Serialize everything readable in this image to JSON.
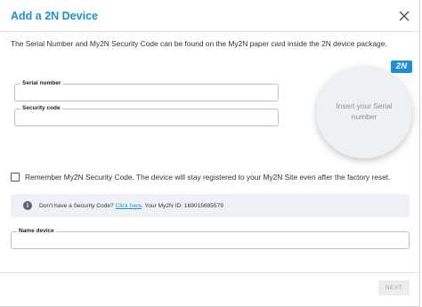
{
  "dialog": {
    "title": "Add a 2N Device",
    "description": "The Serial Number and My2N Security Code can be found on the My2N paper card inside the 2N device package."
  },
  "form": {
    "serial_label": "Serial number",
    "serial_value": "",
    "security_label": "Security code",
    "security_value": "",
    "name_label": "Name device",
    "name_value": ""
  },
  "logo": {
    "text": "2N"
  },
  "scan": {
    "hint": "Insert your Serial number"
  },
  "remember": {
    "checked": false,
    "label": "Remember My2N Security Code. The device will stay registered to your My2N Site even after the factory reset."
  },
  "info": {
    "prefix": "Don't have a Security Code?",
    "link": "Click here",
    "suffix": ". Your My2N ID: 169015685579"
  },
  "footer": {
    "next_label": "NEXT",
    "next_enabled": false
  },
  "colors": {
    "accent": "#1e8fd4",
    "disabled_bg": "#ededed",
    "info_bg": "#eef2f6"
  },
  "icons": {
    "close": "close-icon",
    "info": "info-icon",
    "checkbox": "checkbox-unchecked"
  }
}
